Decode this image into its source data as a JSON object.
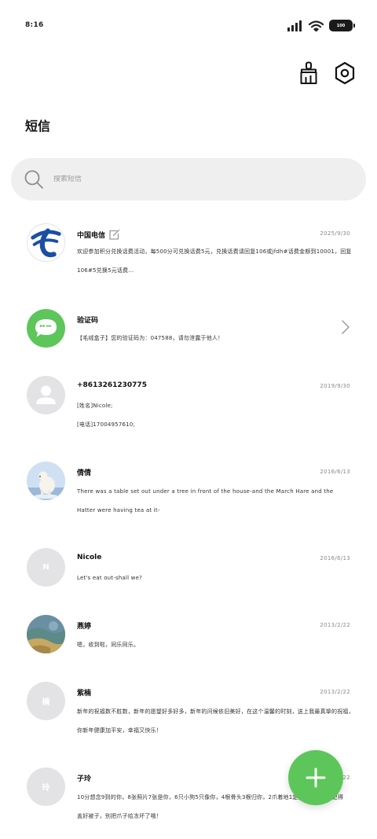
{
  "status_bar": {
    "time": "8:16",
    "battery": "100"
  },
  "title": "短信",
  "search": {
    "placeholder": "搜索短信"
  },
  "toolbar": {
    "clean_icon": "broom-icon",
    "settings_icon": "hexagon-settings-icon"
  },
  "conversations": [
    {
      "sender": "中国电信",
      "date": "2025/9/30",
      "avatar": "china-telecom-logo",
      "preview_lines": [
        "欢迎参加积分兑换话费活动，每500分可兑换话费5元，兑换话费请回复106或jfdh#话费金额到10001，回复",
        "106#5兑换5元话费…"
      ]
    },
    {
      "sender": "验证码",
      "date": "",
      "avatar": "verification-code-icon",
      "preview_lines": [
        "【毛绒盒子】您的验证码为：047588，请勿泄露于他人！"
      ]
    },
    {
      "sender": "+8613261230775",
      "date": "2019/9/30",
      "avatar": "default-person-avatar",
      "preview_lines": [
        "[姓名]Nicole;",
        "[电话]17004957610;"
      ]
    },
    {
      "sender": "倩倩",
      "date": "2016/6/13",
      "avatar": "polar-bear-photo",
      "preview_lines": [
        "There  was  a  table  set  out  under  a  tree  in  front  of  the  house-and  the  March  Hare  and  the",
        "Hatter  were  having  tea  at  it-"
      ]
    },
    {
      "sender": "Nicole",
      "date": "2016/6/13",
      "avatar_letter": "N",
      "preview_lines": [
        "Let's  eat  out-shall  we?"
      ]
    },
    {
      "sender": "燕婷",
      "date": "2013/2/22",
      "avatar": "landscape-photo",
      "preview_lines": [
        "嗯，收到啦，同乐同乐。"
      ]
    },
    {
      "sender": "紫楠",
      "date": "2013/2/22",
      "avatar_letter": "楠",
      "preview_lines": [
        "新年的祝福数不胜数，新年的愿望好多好多，新年的问候依旧美好，在这个温馨的时刻，送上我最真挚的祝福，愿",
        "你新年健康加平安，幸福又快乐！"
      ]
    },
    {
      "sender": "子玲",
      "date": "2013/2/22",
      "avatar_letter": "玲",
      "preview_lines": [
        "10分想念9到的你，8张照片7张是你，6只小狗5只像你，4根骨头3根归你，2爪着地1定是你，别忘了记得",
        "盖好被子，别把爪子给冻坏了哦！"
      ]
    }
  ],
  "fab": {
    "icon": "plus-icon",
    "color": "#5dc65a"
  }
}
